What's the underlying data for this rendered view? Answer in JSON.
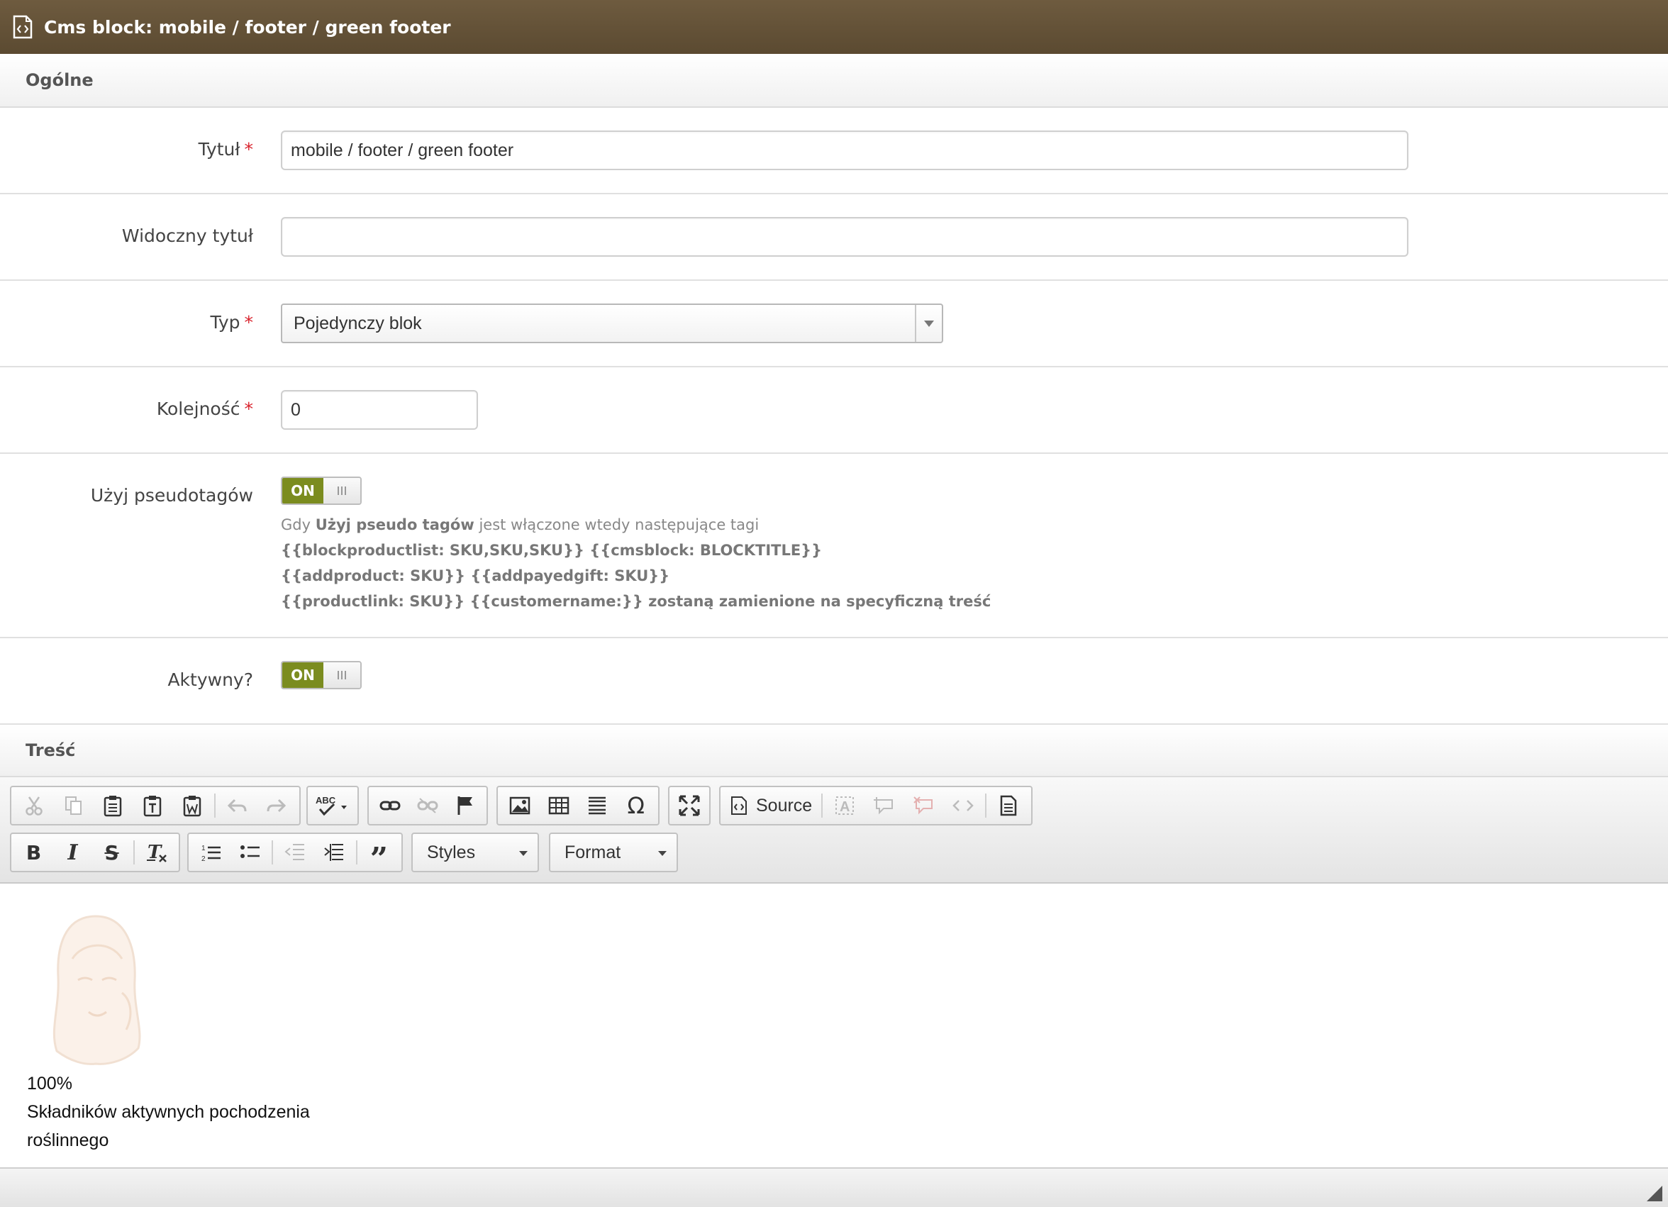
{
  "window": {
    "title": "Cms block: mobile / footer / green footer",
    "icon": "html-document-icon"
  },
  "sections": {
    "general": "Ogólne",
    "content": "Treść"
  },
  "fields": {
    "title": {
      "label": "Tytuł",
      "required": "*",
      "value": "mobile / footer / green footer"
    },
    "visible_title": {
      "label": "Widoczny tytuł",
      "value": ""
    },
    "type": {
      "label": "Typ",
      "required": "*",
      "value": "Pojedynczy blok"
    },
    "order": {
      "label": "Kolejność",
      "required": "*",
      "value": "0"
    },
    "pseudotags": {
      "label": "Użyj pseudotagów",
      "toggle": "ON",
      "help_prefix": "Gdy",
      "help_bold": "Użyj pseudo tagów",
      "help_suffix": "jest włączone wtedy następujące tagi",
      "help_line2": "{{blockproductlist: SKU,SKU,SKU}} {{cmsblock: BLOCKTITLE}}",
      "help_line3": "{{addproduct: SKU}} {{addpayedgift: SKU}}",
      "help_line4": "{{productlink: SKU}} {{customername:}} zostaną zamienione na specyficzną treść"
    },
    "active": {
      "label": "Aktywny?",
      "toggle": "ON"
    }
  },
  "toolbar": {
    "source_label": "Source",
    "styles_label": "Styles",
    "format_label": "Format"
  },
  "editor": {
    "line1": "100%",
    "line2": "Składników aktywnych pochodzenia",
    "line3": "roślinnego"
  },
  "colors": {
    "titlebar": "#6e5b3f",
    "toggle_on": "#7b8c1f",
    "required": "#d9232d"
  }
}
